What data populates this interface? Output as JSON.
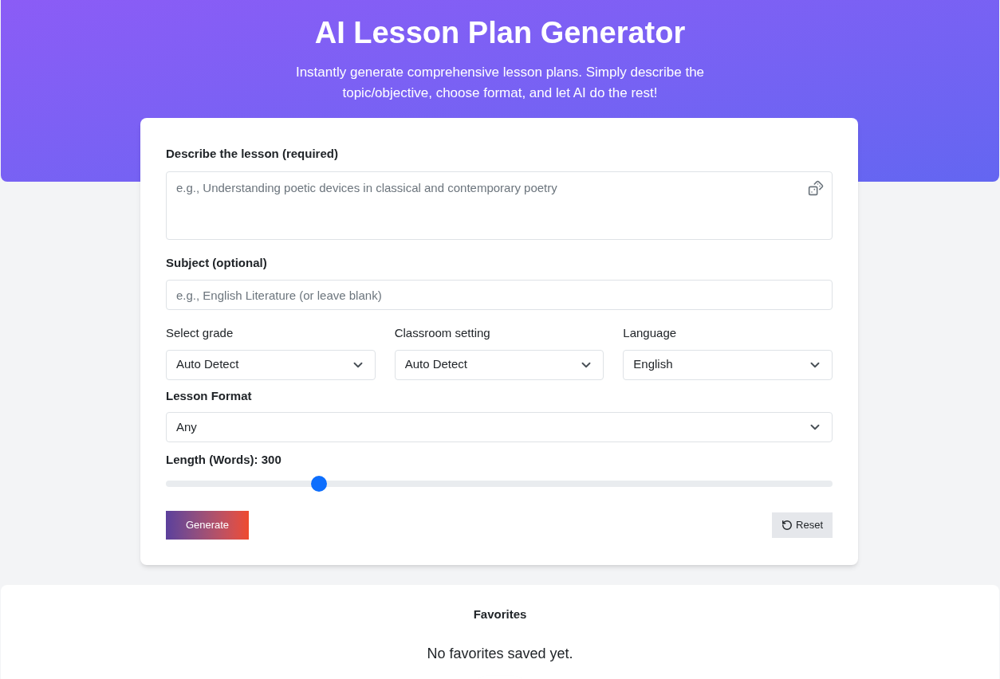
{
  "header": {
    "title": "AI Lesson Plan Generator",
    "subtitle": "Instantly generate comprehensive lesson plans. Simply describe the topic/objective, choose format, and let AI do the rest!"
  },
  "form": {
    "description": {
      "label": "Describe the lesson (required)",
      "placeholder": "e.g., Understanding poetic devices in classical and contemporary poetry"
    },
    "subject": {
      "label": "Subject (optional)",
      "placeholder": "e.g., English Literature (or leave blank)"
    },
    "selects": [
      {
        "label": "Select grade",
        "value": "Auto Detect"
      },
      {
        "label": "Classroom setting",
        "value": "Auto Detect"
      },
      {
        "label": "Language",
        "value": "English"
      }
    ],
    "format": {
      "label": "Lesson Format",
      "value": "Any"
    },
    "length": {
      "label": "Length (Words): 300",
      "level": 0.23
    },
    "generate": "Generate",
    "reset": "Reset"
  },
  "favorites": {
    "title": "Favorites",
    "empty": "No favorites saved yet."
  }
}
